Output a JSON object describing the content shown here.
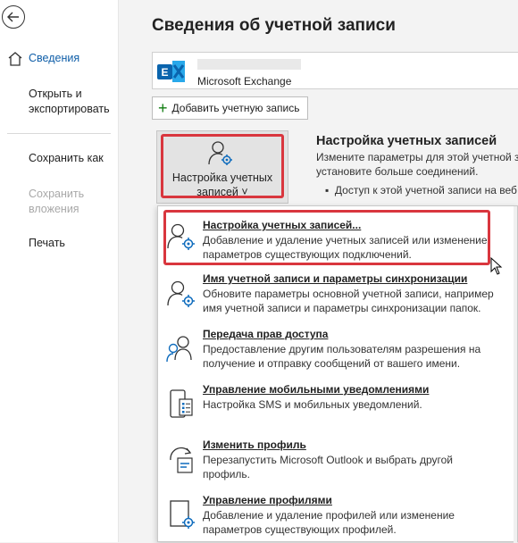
{
  "nav": {
    "items": [
      {
        "label": "Сведения",
        "state": "active"
      },
      {
        "label": "Открыть и\nэкспортировать",
        "state": "normal"
      },
      {
        "label": "Сохранить как",
        "state": "normal"
      },
      {
        "label": "Сохранить\nвложения",
        "state": "disabled"
      },
      {
        "label": "Печать",
        "state": "normal"
      }
    ]
  },
  "main": {
    "title": "Сведения об учетной записи",
    "account": {
      "type": "Microsoft Exchange"
    },
    "add_account_label": "Добавить учетную запись",
    "settings_tile_label": "Настройка учетных\nзаписей ˅",
    "section": {
      "title": "Настройка учетных записей",
      "desc_line1": "Измените параметры для этой учетной за",
      "desc_line2": "установите больше соединений.",
      "bullet": "Доступ к этой учетной записи на веб"
    }
  },
  "menu": {
    "items": [
      {
        "label": "Настройка учетных записей...",
        "desc": "Добавление и удаление учетных записей или изменение параметров существующих подключений."
      },
      {
        "label": "Имя учетной записи и параметры синхронизации",
        "desc": "Обновите параметры основной учетной записи, например имя учетной записи и параметры синхронизации папок."
      },
      {
        "label": "Передача прав доступа",
        "desc": "Предоставление другим пользователям разрешения на получение и отправку сообщений от вашего имени."
      },
      {
        "label": "Управление мобильными уведомлениями",
        "desc": "Настройка SMS и мобильных уведомлений."
      },
      {
        "label": "Изменить профиль",
        "desc": "Перезапустить Microsoft Outlook и выбрать другой профиль."
      },
      {
        "label": "Управление профилями",
        "desc": "Добавление и удаление профилей или изменение параметров существующих профилей."
      }
    ]
  },
  "colors": {
    "accent": "#0f5ea8",
    "highlight": "#d9363e",
    "icon_blue": "#0f6cbd"
  }
}
